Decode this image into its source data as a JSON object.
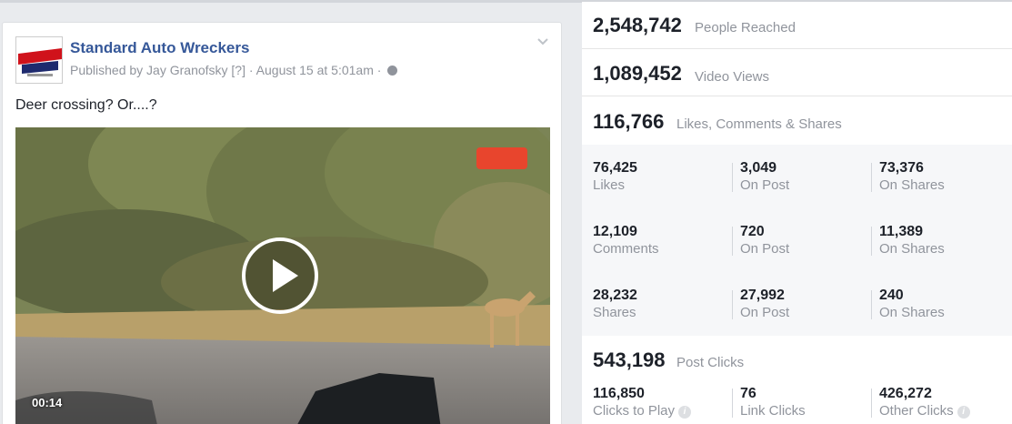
{
  "post": {
    "page_name": "Standard Auto Wreckers",
    "byline_prefix": "Published by Jay Granofsky",
    "byline_bracket": "[?]",
    "byline_date": "· August 15 at 5:01am ·",
    "caption": "Deer crossing? Or....?",
    "video_time": "00:14",
    "watermark": "b"
  },
  "stats": {
    "people_reached": {
      "value": "2,548,742",
      "label": "People Reached"
    },
    "video_views": {
      "value": "1,089,452",
      "label": "Video Views"
    },
    "engagement": {
      "value": "116,766",
      "label": "Likes, Comments & Shares"
    },
    "breakdown": [
      [
        {
          "value": "76,425",
          "label": "Likes"
        },
        {
          "value": "3,049",
          "label": "On Post"
        },
        {
          "value": "73,376",
          "label": "On Shares"
        }
      ],
      [
        {
          "value": "12,109",
          "label": "Comments"
        },
        {
          "value": "720",
          "label": "On Post"
        },
        {
          "value": "11,389",
          "label": "On Shares"
        }
      ],
      [
        {
          "value": "28,232",
          "label": "Shares"
        },
        {
          "value": "27,992",
          "label": "On Post"
        },
        {
          "value": "240",
          "label": "On Shares"
        }
      ]
    ],
    "post_clicks": {
      "value": "543,198",
      "label": "Post Clicks"
    },
    "clicks": [
      {
        "value": "116,850",
        "label": "Clicks to Play"
      },
      {
        "value": "76",
        "label": "Link Clicks"
      },
      {
        "value": "426,272",
        "label": "Other Clicks"
      }
    ],
    "info_glyph": "i"
  }
}
